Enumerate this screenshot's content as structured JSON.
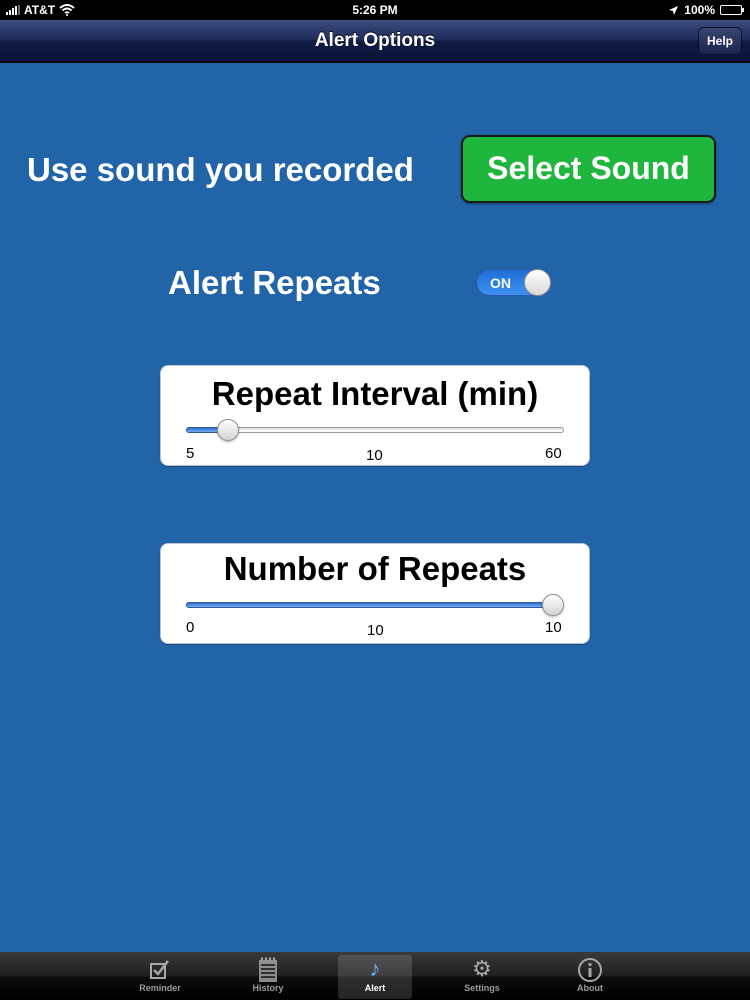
{
  "status_bar": {
    "carrier": "AT&T",
    "time": "5:26 PM",
    "battery": "100%"
  },
  "nav": {
    "title": "Alert Options",
    "help_label": "Help"
  },
  "sound": {
    "label": "Use sound you recorded",
    "button_label": "Select Sound"
  },
  "repeats_toggle": {
    "label": "Alert Repeats",
    "state_label": "ON",
    "on": true
  },
  "interval": {
    "title": "Repeat Interval (min)",
    "min_label": "5",
    "mid_label": "10",
    "max_label": "60",
    "min": 5,
    "max": 60,
    "value": 10
  },
  "count": {
    "title": "Number of Repeats",
    "min_label": "0",
    "mid_label": "10",
    "max_label": "10",
    "min": 0,
    "max": 10,
    "value": 10
  },
  "tabs": [
    {
      "label": "Reminder",
      "icon": "checkbox-icon",
      "active": false
    },
    {
      "label": "History",
      "icon": "notepad-icon",
      "active": false
    },
    {
      "label": "Alert",
      "icon": "music-note-icon",
      "active": true
    },
    {
      "label": "Settings",
      "icon": "gear-icon",
      "active": false
    },
    {
      "label": "About",
      "icon": "info-icon",
      "active": false
    }
  ],
  "colors": {
    "background": "#2264a8",
    "select_button": "#1eb63c",
    "toggle_on": "#2a7de6"
  }
}
